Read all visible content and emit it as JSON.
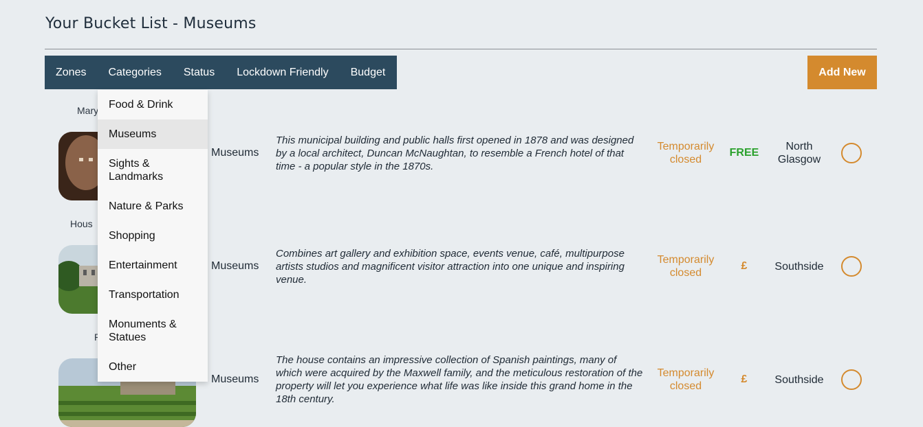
{
  "page": {
    "title": "Your Bucket List - Museums"
  },
  "nav": {
    "items": [
      {
        "label": "Zones"
      },
      {
        "label": "Categories"
      },
      {
        "label": "Status"
      },
      {
        "label": "Lockdown Friendly"
      },
      {
        "label": "Budget"
      }
    ],
    "add_new_label": "Add New"
  },
  "dropdown": {
    "items": [
      {
        "label": "Food & Drink"
      },
      {
        "label": "Museums"
      },
      {
        "label": "Sights & Landmarks"
      },
      {
        "label": "Nature & Parks"
      },
      {
        "label": "Shopping"
      },
      {
        "label": "Entertainment"
      },
      {
        "label": "Transportation"
      },
      {
        "label": "Monuments & Statues"
      },
      {
        "label": "Other"
      }
    ],
    "selected": "Museums"
  },
  "rows": [
    {
      "title_partial": "Mary",
      "category": "Museums",
      "description": "This municipal building and public halls first opened in 1878 and was designed by a local architect, Duncan McNaughtan, to resemble a French hotel of that time - a popular style in the 1870s.",
      "status": "Temporarily closed",
      "price": "FREE",
      "zone": "North Glasgow"
    },
    {
      "title_partial": "Hous",
      "category": "Museums",
      "description": "Combines art gallery and exhibition space, events venue, café, multipurpose artists studios and magnificent visitor attraction into one unique and inspiring venue.",
      "status": "Temporarily closed",
      "price": "£",
      "zone": "Southside"
    },
    {
      "title_partial": "P",
      "category": "Museums",
      "description": "The house contains an impressive collection of Spanish paintings, many of which were acquired by the Maxwell family, and the meticulous restoration of the property will let you experience what life was like inside this grand home in the 18th century.",
      "status": "Temporarily closed",
      "price": "£",
      "zone": "Southside"
    }
  ],
  "colors": {
    "navbar": "#2c4a5e",
    "accent": "#d48a2e",
    "free": "#2aa12c",
    "background": "#e9edf0"
  }
}
